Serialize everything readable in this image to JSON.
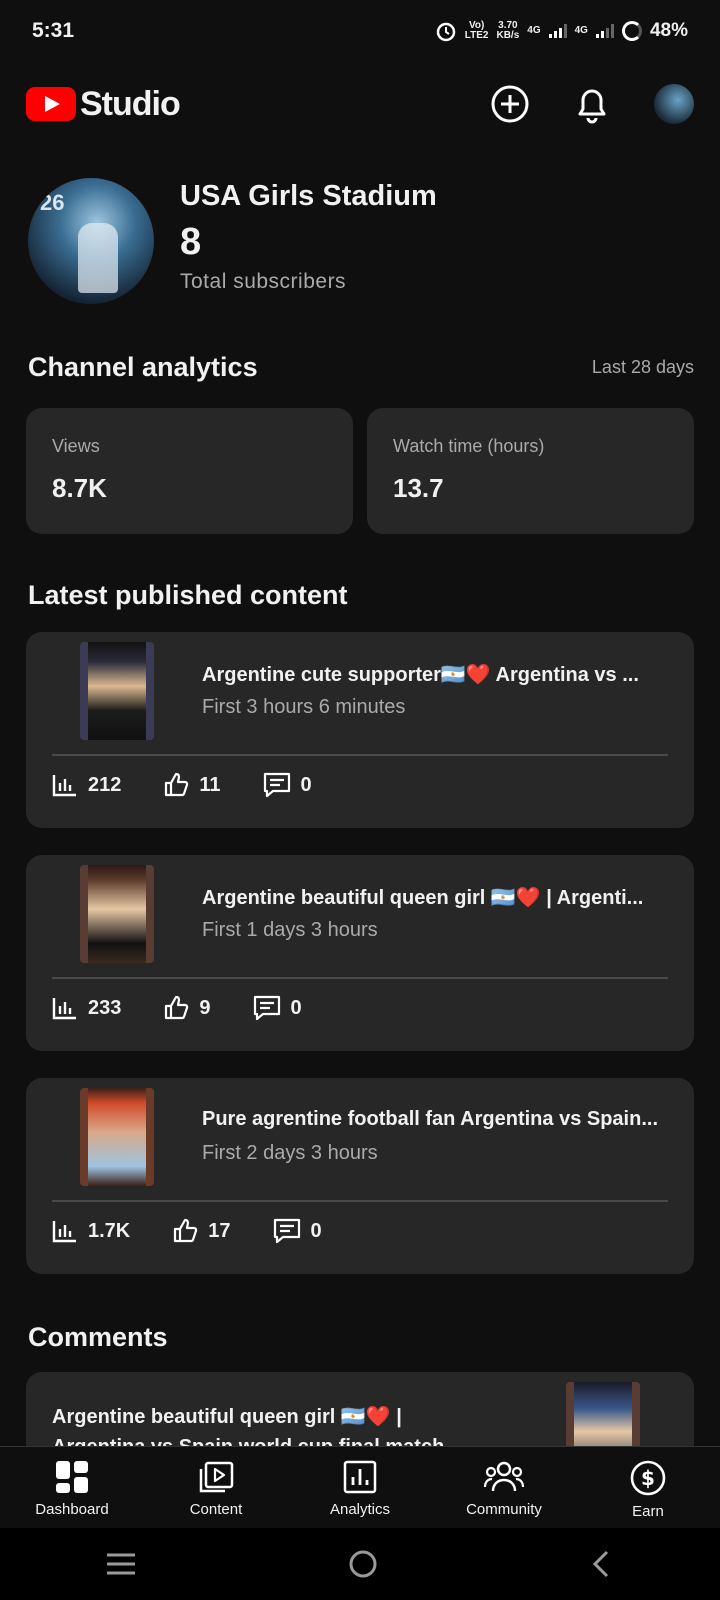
{
  "status": {
    "time": "5:31",
    "volte": "Vo)\nLTE2",
    "speed": "3.70\nKB/s",
    "net1": "4G",
    "net2": "4G",
    "battery": "48%"
  },
  "header": {
    "app_name": "Studio",
    "icons": [
      "create-icon",
      "bell-icon",
      "account-avatar"
    ]
  },
  "channel": {
    "name": "USA Girls Stadium",
    "subscribers": "8",
    "subscribers_label": "Total subscribers"
  },
  "analytics": {
    "title": "Channel analytics",
    "period": "Last 28 days",
    "cards": [
      {
        "label": "Views",
        "value": "8.7K"
      },
      {
        "label": "Watch time (hours)",
        "value": "13.7"
      }
    ]
  },
  "latest": {
    "title": "Latest published content",
    "videos": [
      {
        "title": "Argentine cute supporter🇦🇷❤️ Argentina vs ...",
        "age": "First 3 hours 6 minutes",
        "views": "212",
        "likes": "11",
        "comments": "0"
      },
      {
        "title": "Argentine beautiful queen girl 🇦🇷❤️ | Argenti...",
        "age": "First 1 days 3 hours",
        "views": "233",
        "likes": "9",
        "comments": "0"
      },
      {
        "title": "Pure agrentine football fan Argentina vs Spain...",
        "age": "First 2 days 3 hours",
        "views": "1.7K",
        "likes": "17",
        "comments": "0"
      }
    ]
  },
  "comments": {
    "title": "Comments",
    "first_text": "Argentine beautiful queen girl 🇦🇷❤️ | Argentina vs Spain world cup final match highl"
  },
  "nav": {
    "items": [
      {
        "label": "Dashboard",
        "icon": "dashboard-icon"
      },
      {
        "label": "Content",
        "icon": "content-icon"
      },
      {
        "label": "Analytics",
        "icon": "analytics-icon"
      },
      {
        "label": "Community",
        "icon": "community-icon"
      },
      {
        "label": "Earn",
        "icon": "earn-icon"
      }
    ]
  },
  "colors": {
    "background": "#0f0f0f",
    "card": "#272727",
    "brand_red": "#ff0000",
    "muted": "#aaaaaa"
  }
}
